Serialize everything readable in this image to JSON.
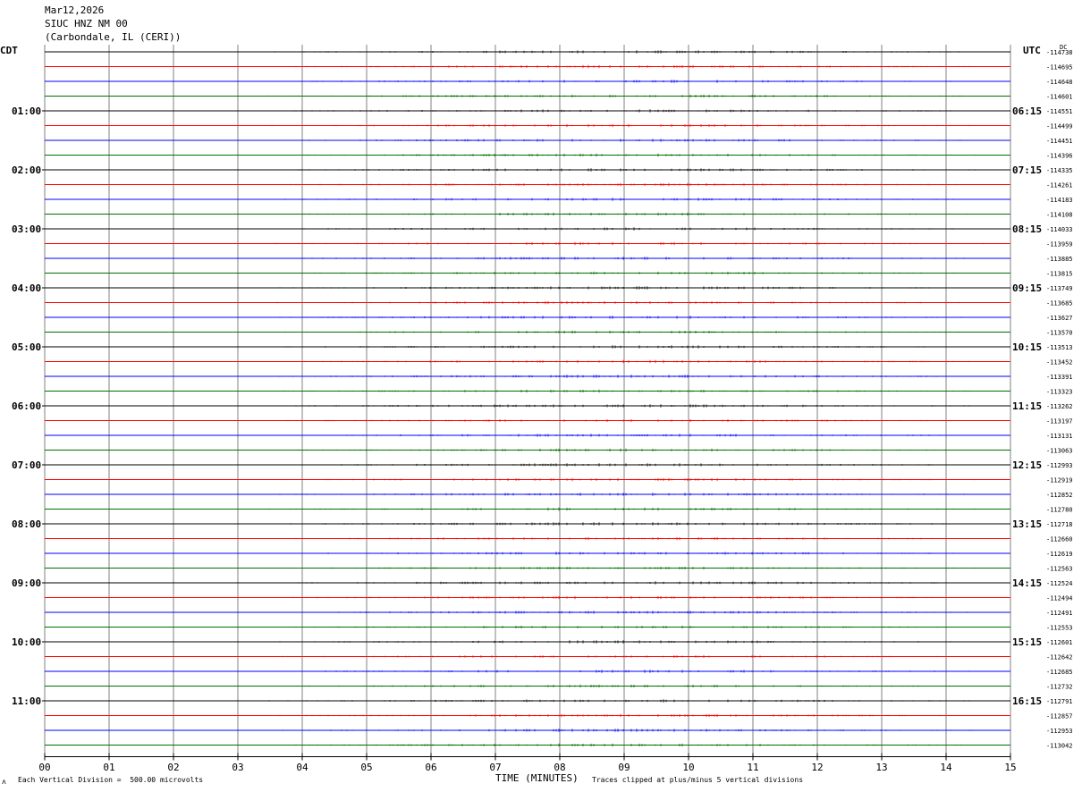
{
  "header": {
    "date": "Mar12,2026",
    "station": "SIUC HNZ NM 00",
    "location": "(Carbondale, IL (CERI))"
  },
  "tz": {
    "left": "CDT",
    "right": "UTC",
    "dc": "DC"
  },
  "footer": {
    "scale": "Each Vertical Division =  500.00 microvolts",
    "xlabel": "TIME (MINUTES)",
    "clip": "Traces clipped at plus/minus 5 vertical divisions",
    "mark": "ʌ"
  },
  "colors": {
    "cycle": [
      "#000000",
      "#ff0000",
      "#0000ff",
      "#007000"
    ],
    "grid": "#808080"
  },
  "chart_data": {
    "type": "line",
    "title": "",
    "x_ticks": [
      "00",
      "01",
      "02",
      "03",
      "04",
      "05",
      "06",
      "07",
      "08",
      "09",
      "10",
      "11",
      "12",
      "13",
      "14",
      "15"
    ],
    "xlim": [
      0,
      15
    ],
    "left_hour_labels": [
      "01:00",
      "02:00",
      "03:00",
      "04:00",
      "05:00",
      "06:00",
      "07:00",
      "08:00",
      "09:00",
      "10:00",
      "11:00"
    ],
    "right_hour_labels": [
      "06:15",
      "07:15",
      "08:15",
      "09:15",
      "10:15",
      "11:15",
      "12:15",
      "13:15",
      "14:15",
      "15:15",
      "16:15"
    ],
    "dc_offsets": [
      "-114738",
      "-114695",
      "-114648",
      "-114601",
      "-114551",
      "-114499",
      "-114451",
      "-114396",
      "-114335",
      "-114261",
      "-114183",
      "-114108",
      "-114033",
      "-113959",
      "-113885",
      "-113815",
      "-113749",
      "-113685",
      "-113627",
      "-113570",
      "-113513",
      "-113452",
      "-113391",
      "-113323",
      "-113262",
      "-113197",
      "-113131",
      "-113063",
      "-112993",
      "-112919",
      "-112852",
      "-112780",
      "-112718",
      "-112660",
      "-112619",
      "-112563",
      "-112524",
      "-112494",
      "-112491",
      "-112553",
      "-112601",
      "-112642",
      "-112685",
      "-112732",
      "-112791",
      "-112857",
      "-112953",
      "-113042"
    ]
  }
}
